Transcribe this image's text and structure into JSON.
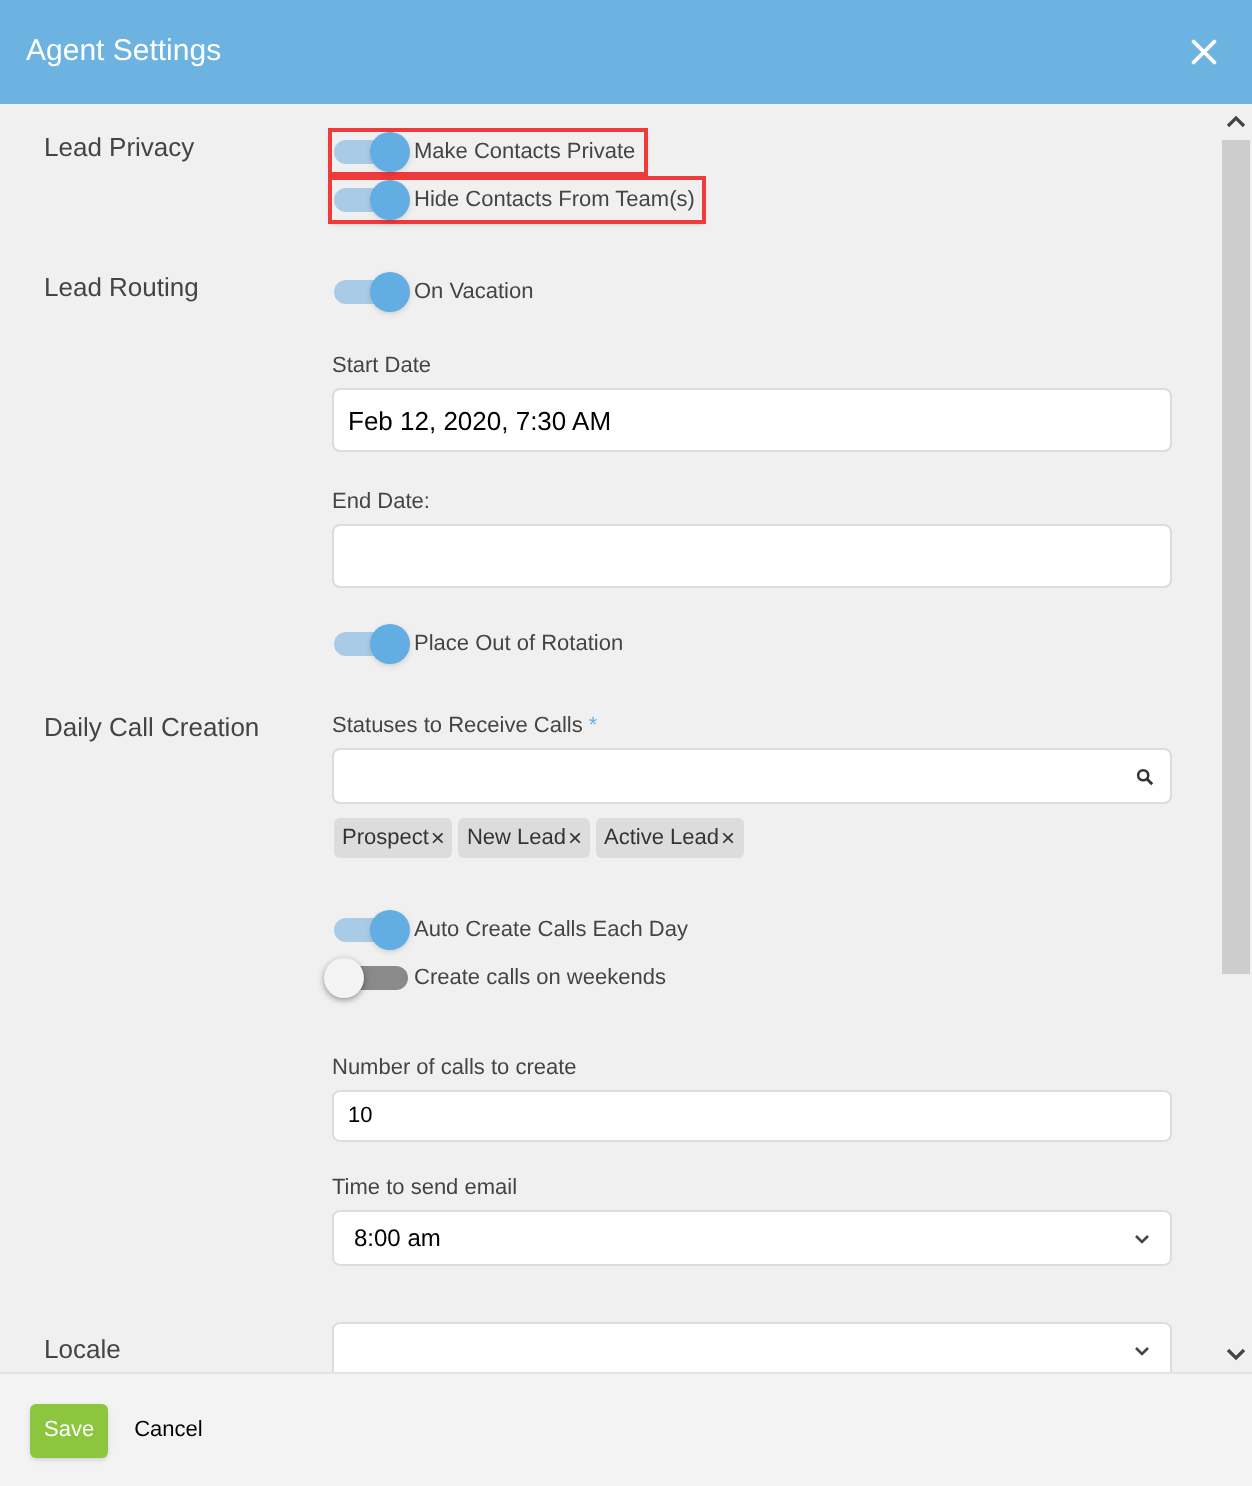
{
  "window": {
    "title": "Agent Settings"
  },
  "sections": [
    {
      "label": "Lead Privacy",
      "items": [
        {
          "kind": "toggle",
          "label": "Make Contacts Private",
          "on": true,
          "highlighted": true
        },
        {
          "kind": "toggle",
          "label": "Hide Contacts From Team(s)",
          "on": true,
          "highlighted": true
        }
      ]
    },
    {
      "label": "Lead Routing",
      "items": [
        {
          "kind": "toggle",
          "label": "On Vacation",
          "on": true,
          "highlighted": false
        },
        {
          "kind": "date",
          "label": "Start Date",
          "value": "Feb 12, 2020, 7:30 AM"
        },
        {
          "kind": "date",
          "label": "End Date:"
        },
        {
          "kind": "toggle",
          "label": "Place Out of Rotation",
          "on": true,
          "highlighted": false
        }
      ]
    },
    {
      "label": "Daily Call Creation",
      "items": [
        {
          "kind": "tags",
          "label": "Statuses to Receive Calls",
          "required": "*",
          "tags": [
            {
              "text": "Prospect",
              "remove": "×"
            },
            {
              "text": "New Lead",
              "remove": "×"
            },
            {
              "text": "Active Lead",
              "remove": "×"
            }
          ]
        },
        {
          "kind": "toggle",
          "label": "Auto Create Calls Each Day",
          "on": true,
          "highlighted": false
        },
        {
          "kind": "toggle",
          "label": "Create calls on weekends",
          "on": false,
          "highlighted": false
        },
        {
          "kind": "number",
          "label": "Number of calls to create",
          "value": "10"
        },
        {
          "kind": "select",
          "label": "Time to send email",
          "value": "8:00 am"
        }
      ]
    },
    {
      "label": "Locale",
      "items": [
        {
          "kind": "select_cut"
        }
      ]
    }
  ],
  "buttons": [
    {
      "label": "Save",
      "kind": "primary"
    },
    {
      "label": "Cancel",
      "kind": "plain"
    }
  ]
}
